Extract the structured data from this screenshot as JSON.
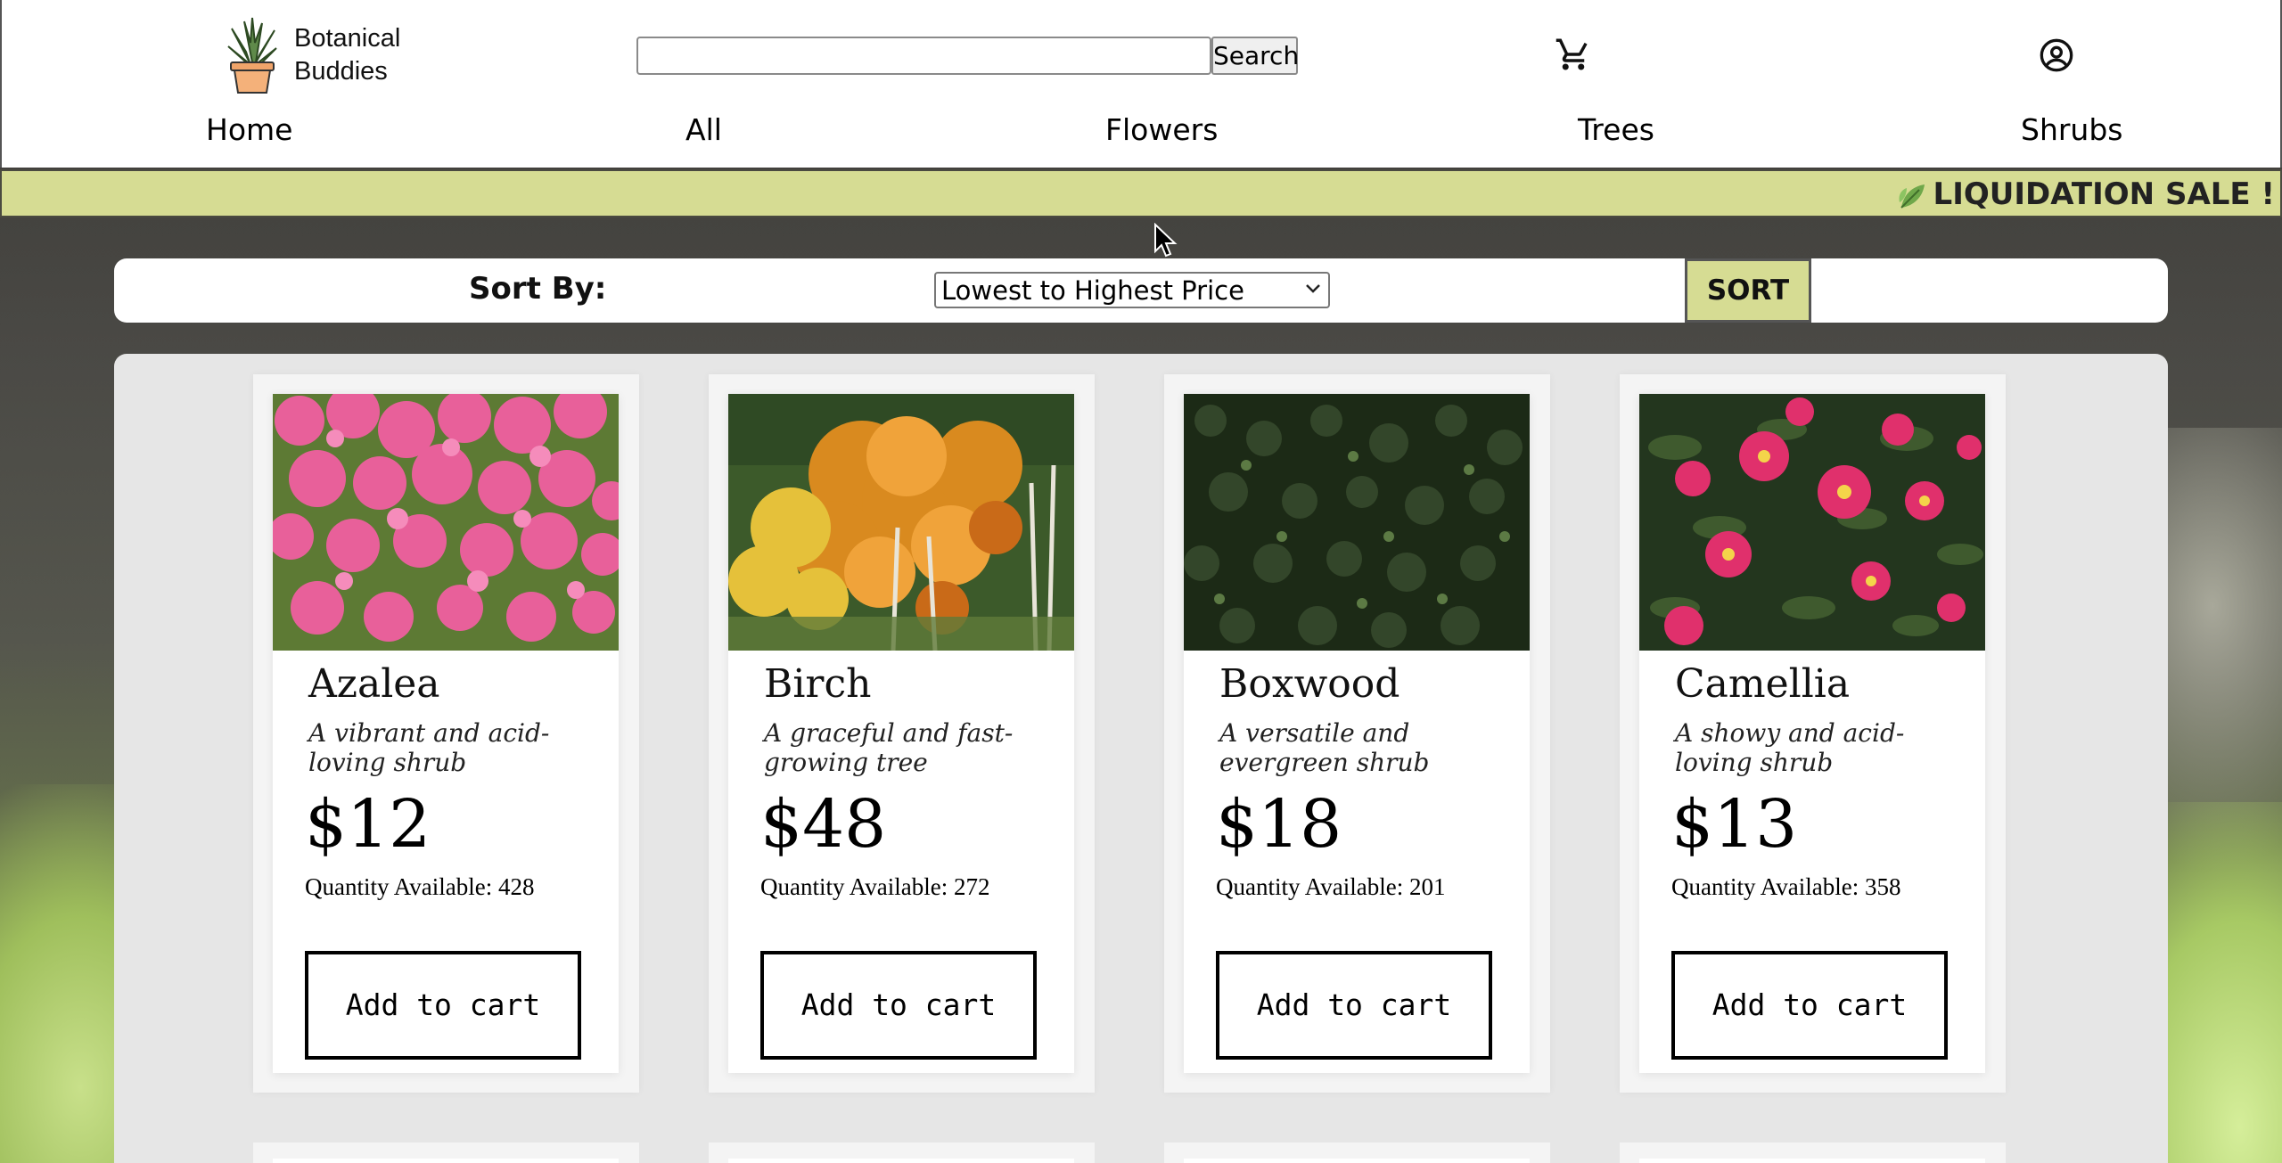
{
  "brand": {
    "line1": "Botanical",
    "line2": "Buddies"
  },
  "search": {
    "placeholder": "",
    "button_label": "Search"
  },
  "nav": [
    "Home",
    "All",
    "Flowers",
    "Trees",
    "Shrubs"
  ],
  "banner": {
    "text": "LIQUIDATION SALE !",
    "icon": "leaf-icon"
  },
  "sort": {
    "label": "Sort By:",
    "selected": "Lowest to Highest Price",
    "button_label": "SORT"
  },
  "colors": {
    "accent": "#d6dc93",
    "panel": "#e6e6e6"
  },
  "products": [
    {
      "name": "Azalea",
      "description": "A vibrant and acid-loving shrub",
      "price": "$12",
      "quantity_label": "Quantity Available: 428",
      "button_label": "Add to cart"
    },
    {
      "name": "Birch",
      "description": "A graceful and fast-growing tree",
      "price": "$48",
      "quantity_label": "Quantity Available: 272",
      "button_label": "Add to cart"
    },
    {
      "name": "Boxwood",
      "description": "A versatile and evergreen shrub",
      "price": "$18",
      "quantity_label": "Quantity Available: 201",
      "button_label": "Add to cart"
    },
    {
      "name": "Camellia",
      "description": "A showy and acid-loving shrub",
      "price": "$13",
      "quantity_label": "Quantity Available: 358",
      "button_label": "Add to cart"
    }
  ]
}
